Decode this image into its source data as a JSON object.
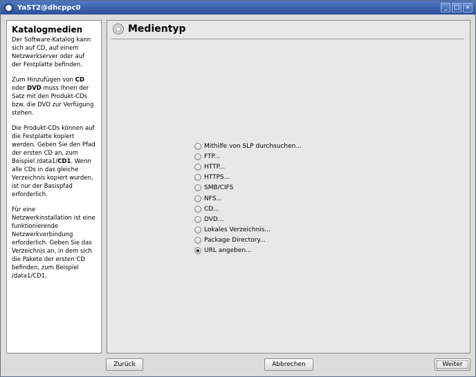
{
  "window": {
    "title": "YaST2@dhcppc0",
    "minimize": "_",
    "maximize": "□",
    "close": "×"
  },
  "help": {
    "title": "Katalogmedien",
    "p1": "Der Software-Katalog kann sich auf CD, auf einem Netzwerkserver oder auf der Festplatte befinden.",
    "p2_a": "Zum Hinzufügen von ",
    "p2_b": "CD",
    "p2_c": " oder ",
    "p2_d": "DVD",
    "p2_e": " muss Ihnen der Satz mit den Produkt-CDs bzw. die DVD zur Verfügung stehen.",
    "p3_a": "Die Produkt-CDs können auf die Festplatte kopiert werden. Geben Sie den Pfad der ersten CD an, zum Beispiel /data1/",
    "p3_b": "CD1",
    "p3_c": ". Wenn alle CDs in das gleiche Verzeichnis kopiert wurden, ist nur der Basispfad erforderlich.",
    "p4": "Für eine Netzwerkinstallation ist eine funktionierende Netzwerkverbindung erforderlich. Geben Sie das Verzeichnis an, in dem sich die Pakete der ersten CD befinden, zum Beispiel /data1/CD1."
  },
  "main": {
    "title": "Medientyp",
    "options": [
      {
        "label": "Mithilfe von SLP durchsuchen...",
        "checked": false
      },
      {
        "label": "FTP...",
        "checked": false
      },
      {
        "label": "HTTP...",
        "checked": false
      },
      {
        "label": "HTTPS...",
        "checked": false
      },
      {
        "label": "SMB/CIFS",
        "checked": false
      },
      {
        "label": "NFS...",
        "checked": false
      },
      {
        "label": "CD...",
        "checked": false
      },
      {
        "label": "DVD...",
        "checked": false
      },
      {
        "label": "Lokales Verzeichnis...",
        "checked": false
      },
      {
        "label": "Package Directory...",
        "checked": false
      },
      {
        "label": "URL angeben...",
        "checked": true
      }
    ]
  },
  "buttons": {
    "back": "Zurück",
    "abort": "Abbrechen",
    "next": "Weiter"
  }
}
